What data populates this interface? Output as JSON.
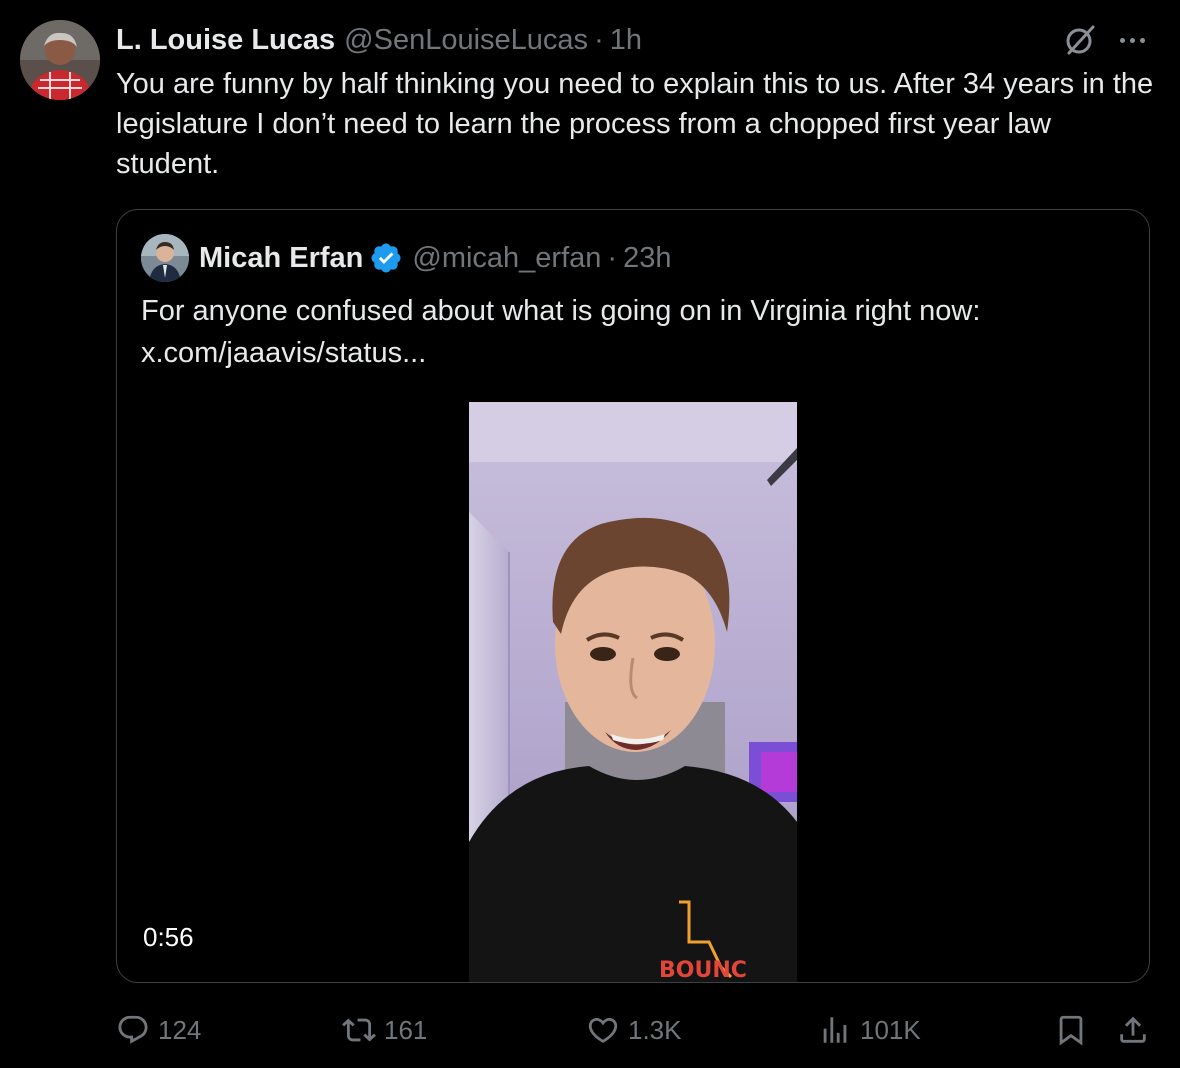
{
  "tweet": {
    "author": {
      "display_name": "L. Louise Lucas",
      "handle": "@SenLouiseLucas",
      "separator": "·",
      "time": "1h",
      "avatar_icon": "avatar-photo"
    },
    "text": "You are funny by half thinking you need to explain this to us.  After 34 years in the legislature I don’t need to learn the process from a chopped first year law student.",
    "icons": {
      "grok": "grok-icon",
      "more": "more-icon"
    }
  },
  "quoted_tweet": {
    "author": {
      "display_name": "Micah Erfan",
      "handle": "@micah_erfan",
      "separator": "·",
      "time": "23h",
      "verified": true,
      "verified_color": "#1d9bf0"
    },
    "text_line1": "For anyone confused about what is going on in Virginia right now:",
    "text_line2": "x.com/jaaavis/status...",
    "video": {
      "duration": "0:56"
    }
  },
  "actions": {
    "replies": "124",
    "reposts": "161",
    "likes": "1.3K",
    "views": "101K"
  },
  "colors": {
    "background": "#000000",
    "text_primary": "#e7e9ea",
    "text_secondary": "#71767b",
    "border": "#2f3336",
    "accent": "#1d9bf0"
  }
}
